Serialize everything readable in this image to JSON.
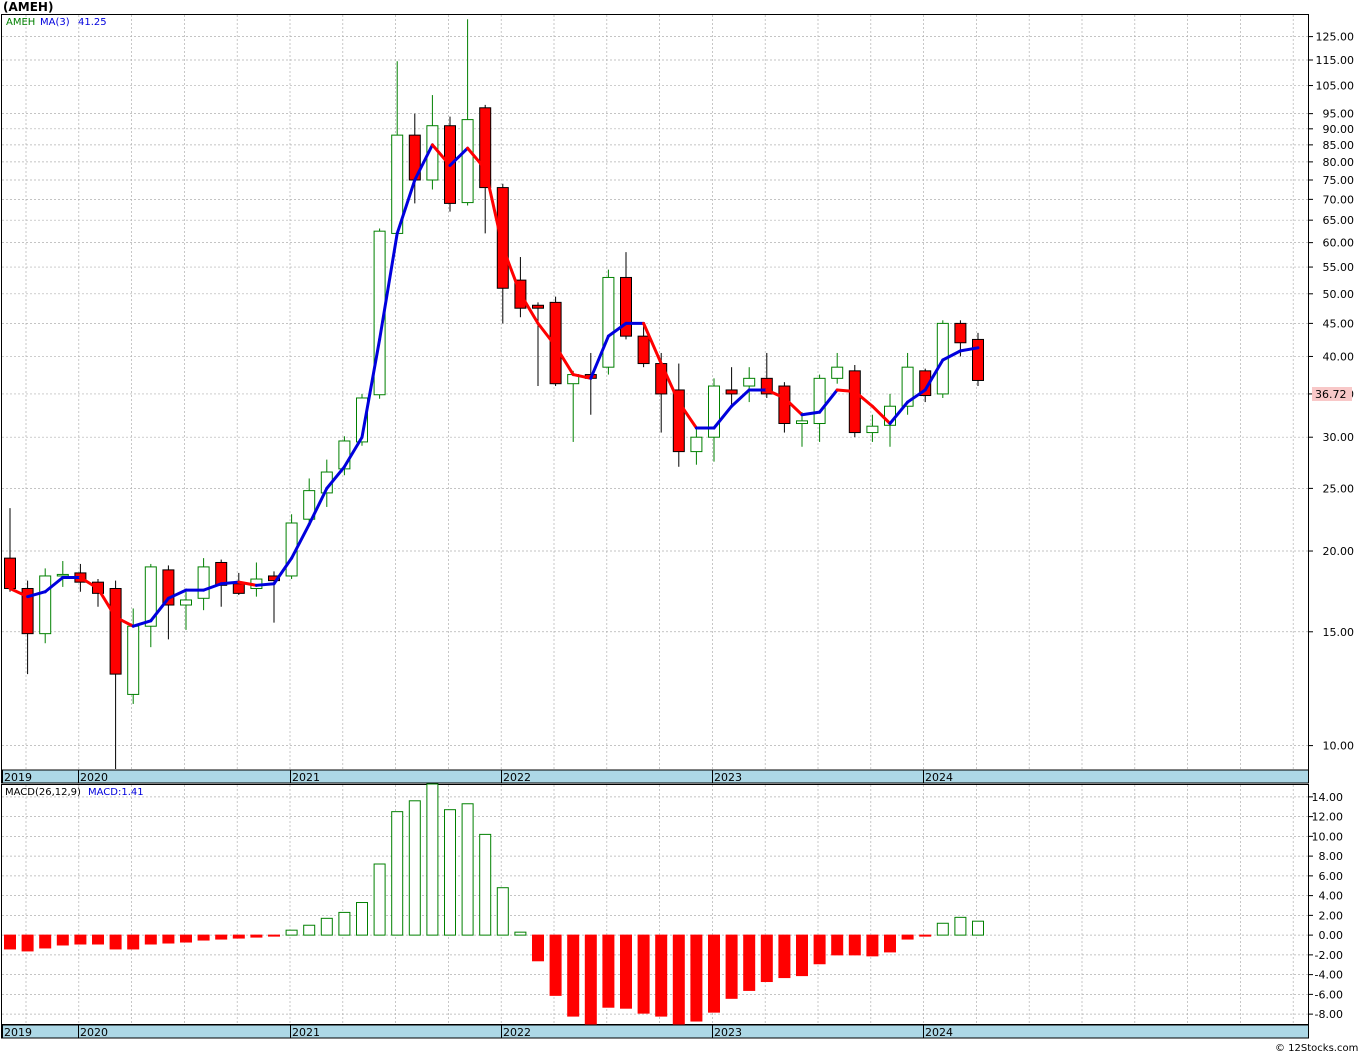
{
  "ticker_label": "(AMEH)",
  "legend": {
    "symbol": "AMEH",
    "ma_label": "MA(3)",
    "ma_value": "41.25"
  },
  "macd_legend": {
    "label": "MACD(26,12,9)",
    "value_label": "MACD:1.41"
  },
  "last_price_label": "36.72",
  "watermark": "© 12Stocks.com",
  "colors": {
    "up_candle": "#008000",
    "down_candle": "#ff0000",
    "ma_up": "#0000dd",
    "ma_down": "#ff0000",
    "grid": "#b0b0b0",
    "axis_band": "#add8e6",
    "last_price_box": "#f8c8c8"
  },
  "chart_data": [
    {
      "type": "candlestick",
      "title": "(AMEH)",
      "scale": "log",
      "ylim": [
        9.2,
        135
      ],
      "y_ticks": [
        10,
        15,
        20,
        25,
        30,
        35,
        40,
        45,
        50,
        55,
        60,
        65,
        70,
        75,
        80,
        85,
        90,
        95,
        105,
        115,
        125
      ],
      "year_labels": [
        "2019",
        "2020",
        "2021",
        "2022",
        "2023",
        "2024"
      ],
      "grid": true,
      "ohlc": [
        [
          19.5,
          23.3,
          17.3,
          17.5
        ],
        [
          17.5,
          18.0,
          12.9,
          14.9
        ],
        [
          14.9,
          18.8,
          14.4,
          18.3
        ],
        [
          18.3,
          19.3,
          17.6,
          18.4
        ],
        [
          18.5,
          19.1,
          17.3,
          17.9
        ],
        [
          17.9,
          18.1,
          16.4,
          17.2
        ],
        [
          17.5,
          18.0,
          9.2,
          12.9
        ],
        [
          12.0,
          16.3,
          11.6,
          15.3
        ],
        [
          15.3,
          19.1,
          14.2,
          18.9
        ],
        [
          18.7,
          19.0,
          14.6,
          16.5
        ],
        [
          16.5,
          17.3,
          15.1,
          16.8
        ],
        [
          16.9,
          19.5,
          16.2,
          18.9
        ],
        [
          19.2,
          19.4,
          16.4,
          17.7
        ],
        [
          17.8,
          18.5,
          17.1,
          17.2
        ],
        [
          17.5,
          19.2,
          17.0,
          18.1
        ],
        [
          18.3,
          18.6,
          15.5,
          18.0
        ],
        [
          18.3,
          22.8,
          18.1,
          22.1
        ],
        [
          22.4,
          25.9,
          22.0,
          24.8
        ],
        [
          24.6,
          27.7,
          23.4,
          26.5
        ],
        [
          26.8,
          30.1,
          26.2,
          29.6
        ],
        [
          29.5,
          35.0,
          29.1,
          34.5
        ],
        [
          34.9,
          63.1,
          34.4,
          62.5
        ],
        [
          62.0,
          114.5,
          61.0,
          88.0
        ],
        [
          88.0,
          95.0,
          69.0,
          75.0
        ],
        [
          75.0,
          101.5,
          72.5,
          91.0
        ],
        [
          91.0,
          94.0,
          67.0,
          69.0
        ],
        [
          69.2,
          133.0,
          68.5,
          93.0
        ],
        [
          97.0,
          98.0,
          62.0,
          73.0
        ],
        [
          73.0,
          74.0,
          45.0,
          51.0
        ],
        [
          52.5,
          57.0,
          46.0,
          47.5
        ],
        [
          48.0,
          48.5,
          36.0,
          47.5
        ],
        [
          48.5,
          49.5,
          36.0,
          36.3
        ],
        [
          36.3,
          38.0,
          29.5,
          37.5
        ],
        [
          37.5,
          40.5,
          32.5,
          37.0
        ],
        [
          38.5,
          54.5,
          37.5,
          53.0
        ],
        [
          53.0,
          58.0,
          42.5,
          43.0
        ],
        [
          43.0,
          45.0,
          38.5,
          39.0
        ],
        [
          39.0,
          40.5,
          30.5,
          35.0
        ],
        [
          35.5,
          39.0,
          27.0,
          28.5
        ],
        [
          28.5,
          31.0,
          27.2,
          30.0
        ],
        [
          30.0,
          37.0,
          27.5,
          36.0
        ],
        [
          35.5,
          38.5,
          33.5,
          35.0
        ],
        [
          36.0,
          38.5,
          34.0,
          37.0
        ],
        [
          37.0,
          40.5,
          34.5,
          35.0
        ],
        [
          36.0,
          36.5,
          30.5,
          31.5
        ],
        [
          31.5,
          32.8,
          29.0,
          31.8
        ],
        [
          31.5,
          37.5,
          29.5,
          37.0
        ],
        [
          37.0,
          40.5,
          36.3,
          38.5
        ],
        [
          38.0,
          38.8,
          30.0,
          30.5
        ],
        [
          30.5,
          32.5,
          29.5,
          31.2
        ],
        [
          31.3,
          35.0,
          29.0,
          33.5
        ],
        [
          33.5,
          40.5,
          32.5,
          38.5
        ],
        [
          38.0,
          38.3,
          34.0,
          34.8
        ],
        [
          35.0,
          45.5,
          34.5,
          45.0
        ],
        [
          45.0,
          45.5,
          40.0,
          42.0
        ],
        [
          42.5,
          43.5,
          36.0,
          36.72
        ]
      ],
      "ma3": [
        17.5,
        17.0,
        17.3,
        18.2,
        18.2,
        17.5,
        15.8,
        15.3,
        15.6,
        16.9,
        17.4,
        17.4,
        17.8,
        17.9,
        17.7,
        17.8,
        19.5,
        22.0,
        25.0,
        27.0,
        30.0,
        42.5,
        62.0,
        75.0,
        85.0,
        79.0,
        84.0,
        78.0,
        59.0,
        50.0,
        45.0,
        41.5,
        37.5,
        37.0,
        43.0,
        45.0,
        45.0,
        39.0,
        34.0,
        31.0,
        31.0,
        33.5,
        35.5,
        35.5,
        34.5,
        32.5,
        32.8,
        35.5,
        35.3,
        33.5,
        31.5,
        34.0,
        35.5,
        39.5,
        40.8,
        41.25
      ]
    },
    {
      "type": "bar",
      "title": "MACD(26,12,9)",
      "ylim": [
        -9.0,
        15.2
      ],
      "y_ticks": [
        -8,
        -6,
        -4,
        -2,
        0,
        2,
        4,
        6,
        8,
        10,
        12,
        14
      ],
      "year_labels": [
        "2019",
        "2020",
        "2021",
        "2022",
        "2023",
        "2024"
      ],
      "values": [
        -1.4,
        -1.6,
        -1.3,
        -1.0,
        -0.9,
        -0.9,
        -1.4,
        -1.4,
        -0.9,
        -0.8,
        -0.7,
        -0.5,
        -0.4,
        -0.3,
        -0.2,
        -0.1,
        0.5,
        1.0,
        1.7,
        2.3,
        3.3,
        7.2,
        12.5,
        13.6,
        15.3,
        12.7,
        13.3,
        10.2,
        4.8,
        0.3,
        -2.6,
        -6.1,
        -8.2,
        -9.0,
        -7.3,
        -7.4,
        -7.9,
        -8.2,
        -9.0,
        -8.7,
        -7.8,
        -6.4,
        -5.6,
        -4.7,
        -4.3,
        -4.1,
        -2.9,
        -2.0,
        -2.0,
        -2.1,
        -1.7,
        -0.4,
        -0.1,
        1.2,
        1.8,
        1.41
      ]
    }
  ]
}
